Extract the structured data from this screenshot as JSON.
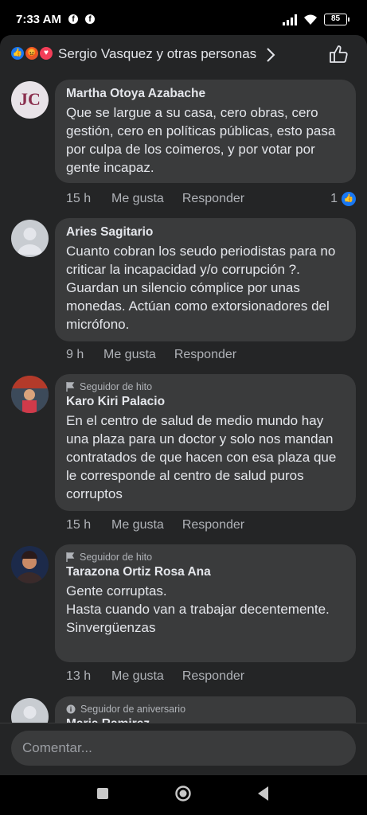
{
  "status_bar": {
    "time": "7:33 AM",
    "battery": "85"
  },
  "reactions": {
    "icons": [
      "like-icon",
      "angry-icon",
      "love-icon"
    ],
    "summary": "Sergio Vasquez y otras personas"
  },
  "comments": [
    {
      "author": "Martha Otoya Azabache",
      "badge": "",
      "text": "Que se largue a su casa, cero obras, cero gestión, cero en políticas públicas, esto pasa por culpa de los coimeros, y por votar por gente incapaz.",
      "time": "15 h",
      "like_label": "Me gusta",
      "reply_label": "Responder",
      "like_count": "1"
    },
    {
      "author": "Aries Sagitario",
      "badge": "",
      "text": "Cuanto cobran los seudo periodistas para no criticar la incapacidad y/o corrupción ?. Guardan un silencio cómplice por unas monedas. Actúan como extorsionadores del micrófono.",
      "time": "9 h",
      "like_label": "Me gusta",
      "reply_label": "Responder"
    },
    {
      "author": "Karo Kiri Palacio",
      "badge": "Seguidor de hito",
      "text": "En el centro de salud de medio mundo hay una plaza para un doctor y solo nos mandan contratados de que hacen con esa plaza que le corresponde al centro de salud puros corruptos",
      "time": "15 h",
      "like_label": "Me gusta",
      "reply_label": "Responder"
    },
    {
      "author": "Tarazona Ortiz Rosa Ana",
      "badge": "Seguidor de hito",
      "text": "Gente corruptas.\nHasta cuando van a trabajar decentemente.\nSinvergüenzas",
      "time": "13 h",
      "like_label": "Me gusta",
      "reply_label": "Responder"
    },
    {
      "author": "Maria Ramirez",
      "badge": "Seguidor de aniversario"
    }
  ],
  "composer": {
    "placeholder": "Comentar..."
  },
  "colors": {
    "background": "#242526",
    "bubble": "#3a3b3c",
    "accent": "#1877f2",
    "secondary_text": "#b0b3b8"
  }
}
